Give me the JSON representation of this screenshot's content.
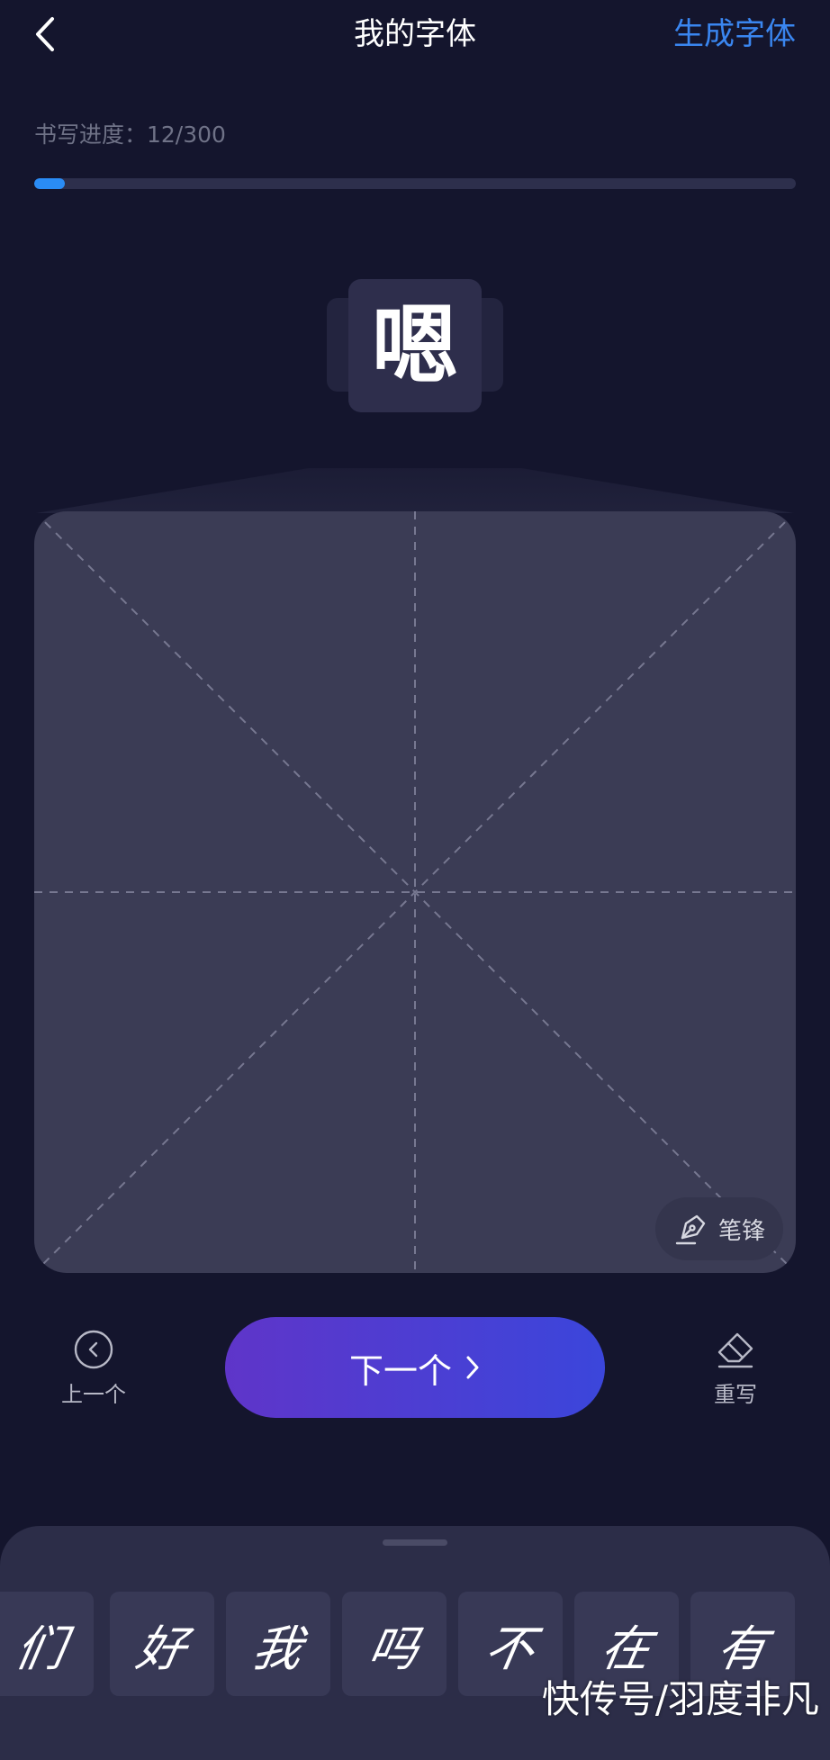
{
  "header": {
    "back_icon": "chevron-left-icon",
    "title": "我的字体",
    "generate_label": "生成字体"
  },
  "progress": {
    "label": "书写进度：12/300",
    "current": 12,
    "total": 300
  },
  "current_char": {
    "glyph": "嗯"
  },
  "pad": {
    "pen_label": "笔锋",
    "pen_icon": "pen-nib-icon"
  },
  "actions": {
    "prev_label": "上一个",
    "prev_icon": "circle-chevron-left-icon",
    "next_label": "下一个",
    "next_icon": "chevron-right-icon",
    "rewrite_label": "重写",
    "rewrite_icon": "eraser-icon"
  },
  "written_chars": [
    "们",
    "好",
    "我",
    "吗",
    "不",
    "在",
    "有"
  ],
  "watermark": "快传号/羽度非凡",
  "colors": {
    "background": "#14152d",
    "accent_blue": "#3a86f0",
    "progress_fill": "#2a8cf5",
    "button_gradient_start": "#5f35c9",
    "button_gradient_end": "#3b46db"
  }
}
